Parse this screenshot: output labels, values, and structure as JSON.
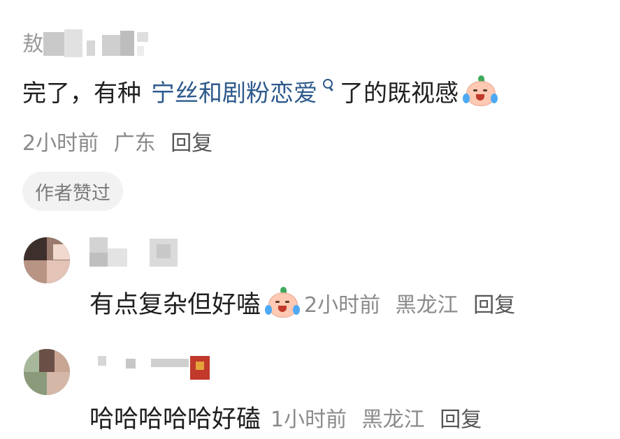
{
  "comment": {
    "username": "敖",
    "text_before": "完了，有种",
    "link_text": "宁丝和剧粉恋爱",
    "text_after": "了的既视感",
    "emoji": "crying-laughing-peach-emoji",
    "time": "2小时前",
    "location": "广东",
    "reply_label": "回复",
    "author_liked": "作者赞过"
  },
  "replies": [
    {
      "text": "有点复杂但好嗑",
      "emoji": "crying-laughing-peach-emoji",
      "time": "2小时前",
      "location": "黑龙江",
      "reply_label": "回复"
    },
    {
      "text": "哈哈哈哈哈好磕",
      "time": "1小时前",
      "location": "黑龙江",
      "reply_label": "回复"
    }
  ],
  "colors": {
    "link": "#2e5a8c",
    "meta": "#8a8a8a",
    "badge_bg": "#f2f2f2"
  }
}
